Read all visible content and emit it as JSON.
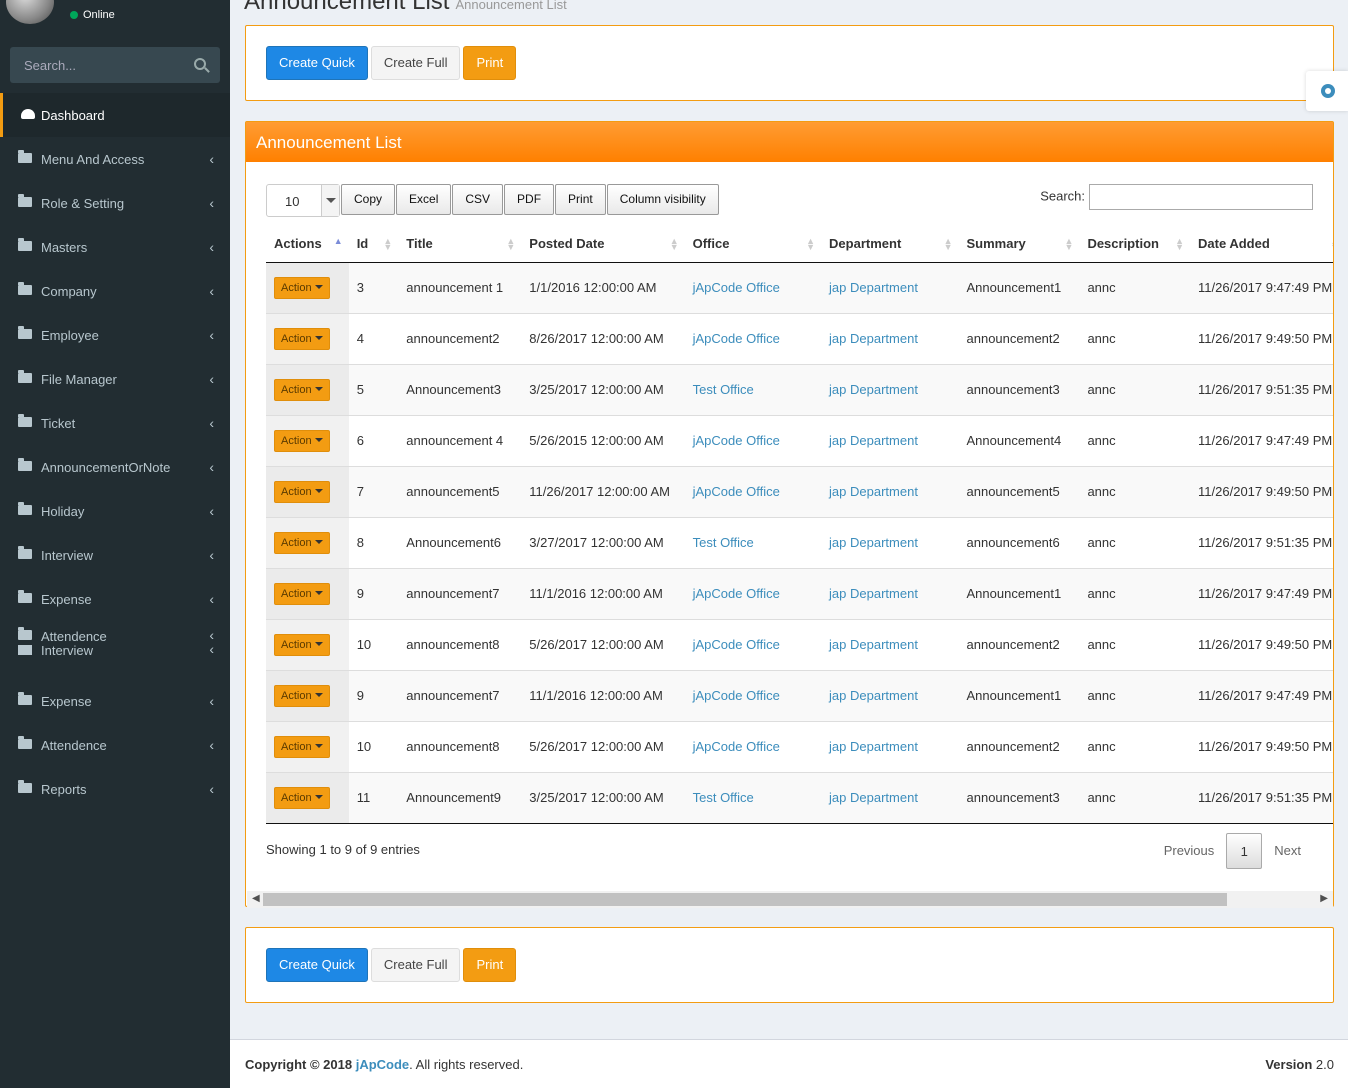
{
  "user": {
    "status": "Online"
  },
  "sidebar": {
    "search_placeholder": "Search...",
    "items": [
      {
        "label": "Dashboard"
      },
      {
        "label": "Menu And Access"
      },
      {
        "label": "Role & Setting"
      },
      {
        "label": "Masters"
      },
      {
        "label": "Company"
      },
      {
        "label": "Employee"
      },
      {
        "label": "File Manager"
      },
      {
        "label": "Ticket"
      },
      {
        "label": "AnnouncementOrNote"
      },
      {
        "label": "Holiday"
      },
      {
        "label": "Interview"
      },
      {
        "label": "Expense"
      },
      {
        "label": "Attendence",
        "label2": "Interview"
      },
      {
        "label": "Expense"
      },
      {
        "label": "Attendence"
      },
      {
        "label": "Reports"
      }
    ]
  },
  "header": {
    "title": "Announcement List",
    "subtitle": "Announcement List"
  },
  "actions": {
    "create_quick": "Create Quick",
    "create_full": "Create Full",
    "print": "Print"
  },
  "list": {
    "title": "Announcement List",
    "page_length": "10",
    "buttons": [
      "Copy",
      "Excel",
      "CSV",
      "PDF",
      "Print",
      "Column visibility"
    ],
    "search_label": "Search:",
    "columns": [
      "Actions",
      "Id",
      "Title",
      "Posted Date",
      "Office",
      "Department",
      "Summary",
      "Description",
      "Date Added"
    ],
    "action_label": "Action",
    "rows": [
      [
        "3",
        "announcement 1",
        "1/1/2016 12:00:00 AM",
        "jApCode Office",
        "jap Department",
        "Announcement1",
        "annc",
        "11/26/2017 9:47:49 PM"
      ],
      [
        "4",
        "announcement2",
        "8/26/2017 12:00:00 AM",
        "jApCode Office",
        "jap Department",
        "announcement2",
        "annc",
        "11/26/2017 9:49:50 PM"
      ],
      [
        "5",
        "Announcement3",
        "3/25/2017 12:00:00 AM",
        "Test Office",
        "jap Department",
        "announcement3",
        "annc",
        "11/26/2017 9:51:35 PM"
      ],
      [
        "6",
        "announcement 4",
        "5/26/2015 12:00:00 AM",
        "jApCode Office",
        "jap Department",
        "Announcement4",
        "annc",
        "11/26/2017 9:47:49 PM"
      ],
      [
        "7",
        "announcement5",
        "11/26/2017 12:00:00 AM",
        "jApCode Office",
        "jap Department",
        "announcement5",
        "annc",
        "11/26/2017 9:49:50 PM"
      ],
      [
        "8",
        "Announcement6",
        "3/27/2017 12:00:00 AM",
        "Test Office",
        "jap Department",
        "announcement6",
        "annc",
        "11/26/2017 9:51:35 PM"
      ],
      [
        "9",
        "announcement7",
        "11/1/2016 12:00:00 AM",
        "jApCode Office",
        "jap Department",
        "Announcement1",
        "annc",
        "11/26/2017 9:47:49 PM"
      ],
      [
        "10",
        "announcement8",
        "5/26/2017 12:00:00 AM",
        "jApCode Office",
        "jap Department",
        "announcement2",
        "annc",
        "11/26/2017 9:49:50 PM"
      ],
      [
        "9",
        "announcement7",
        "11/1/2016 12:00:00 AM",
        "jApCode Office",
        "jap Department",
        "Announcement1",
        "annc",
        "11/26/2017 9:47:49 PM"
      ],
      [
        "10",
        "announcement8",
        "5/26/2017 12:00:00 AM",
        "jApCode Office",
        "jap Department",
        "announcement2",
        "annc",
        "11/26/2017 9:49:50 PM"
      ],
      [
        "11",
        "Announcement9",
        "3/25/2017 12:00:00 AM",
        "Test Office",
        "jap Department",
        "announcement3",
        "annc",
        "11/26/2017 9:51:35 PM"
      ]
    ],
    "info": "Showing 1 to 9 of 9 entries",
    "pagination": {
      "previous": "Previous",
      "current": "1",
      "next": "Next"
    }
  },
  "footer": {
    "copyright_prefix": "Copyright © 2018 ",
    "brand": "jApCode",
    "copyright_suffix": ". All rights reserved.",
    "version_label": "Version",
    "version": "2.0"
  },
  "colors": {
    "accent": "#f39c12",
    "primary": "#1e88e5",
    "link": "#3c8dbc",
    "sidebar": "#222d32"
  }
}
